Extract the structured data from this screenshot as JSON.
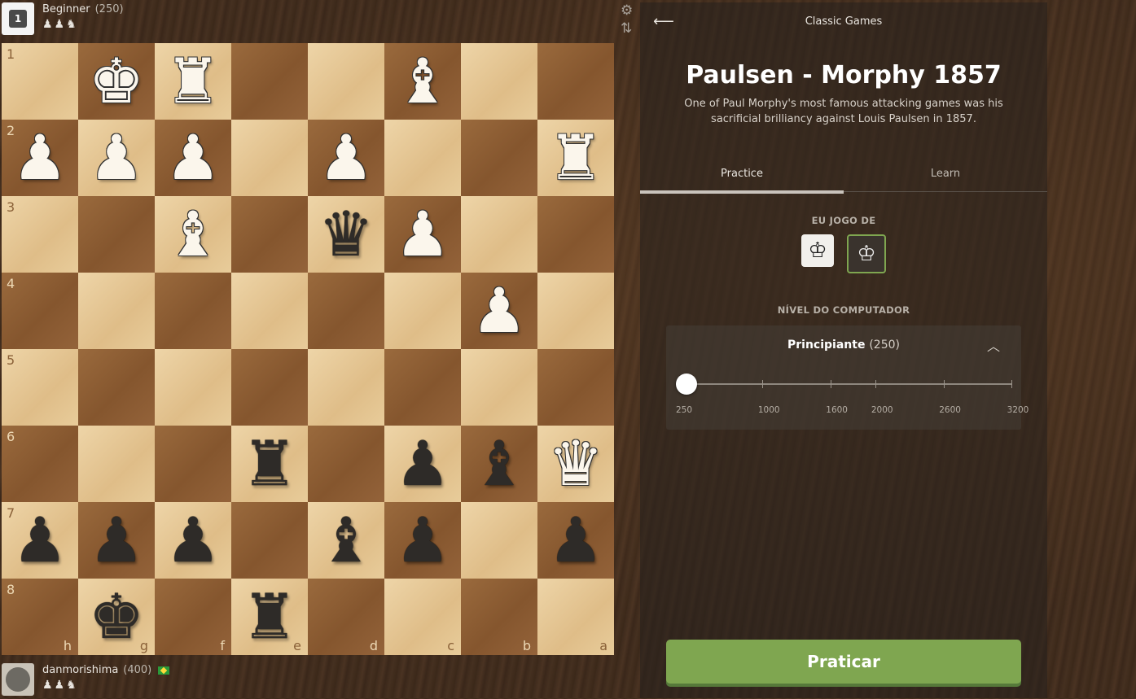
{
  "top_player": {
    "name": "Beginner",
    "rating": "(250)",
    "avatar_label": "1",
    "captured_icons": "♟♟♞"
  },
  "bottom_player": {
    "name": "danmorishima",
    "rating": "(400)",
    "captured_icons": "♟♟♞",
    "flag": "Brazil"
  },
  "board": {
    "ranks": [
      "1",
      "2",
      "3",
      "4",
      "5",
      "6",
      "7",
      "8"
    ],
    "files": [
      "h",
      "g",
      "f",
      "e",
      "d",
      "c",
      "b",
      "a"
    ],
    "squares": [
      [
        "",
        "wK",
        "wR",
        "",
        "",
        "wB",
        "",
        ""
      ],
      [
        "wP",
        "wP",
        "wP",
        "",
        "wP",
        "",
        "",
        "wR"
      ],
      [
        "",
        "",
        "wB",
        "",
        "bQ",
        "wP",
        "",
        ""
      ],
      [
        "",
        "",
        "",
        "",
        "",
        "",
        "wP",
        ""
      ],
      [
        "",
        "",
        "",
        "",
        "",
        "",
        "",
        ""
      ],
      [
        "",
        "",
        "",
        "bR",
        "",
        "bP",
        "bB",
        "wQ"
      ],
      [
        "bP",
        "bP",
        "bP",
        "",
        "bB",
        "bP",
        "",
        "bP"
      ],
      [
        "",
        "bK",
        "",
        "bR",
        "",
        "",
        "",
        ""
      ]
    ],
    "glyphs": {
      "K": "♚",
      "Q": "♛",
      "R": "♜",
      "B": "♝",
      "N": "♞",
      "P": "♟"
    }
  },
  "icons": {
    "settings": "gear-icon",
    "flip": "flip-board-icon",
    "back": "back-arrow-icon",
    "collapse": "chevron-up-icon"
  },
  "panel": {
    "header_title": "Classic Games",
    "game_title": "Paulsen - Morphy 1857",
    "description": "One of Paul Morphy's most famous attacking games was his sacrificial brilliancy against Louis Paulsen in 1857.",
    "tabs": [
      {
        "label": "Practice",
        "active": true
      },
      {
        "label": "Learn",
        "active": false
      }
    ],
    "play_as_label": "EU JOGO DE",
    "play_as_selected": "black",
    "level_label": "NÍVEL DO COMPUTADOR",
    "level_name": "Principiante",
    "level_rating": "(250)",
    "slider": {
      "min": 250,
      "max": 3200,
      "value": 250,
      "ticks": [
        "250",
        "1000",
        "1600",
        "2000",
        "2600",
        "3200"
      ]
    },
    "practice_button": "Praticar",
    "accent_color": "#7fa650"
  }
}
